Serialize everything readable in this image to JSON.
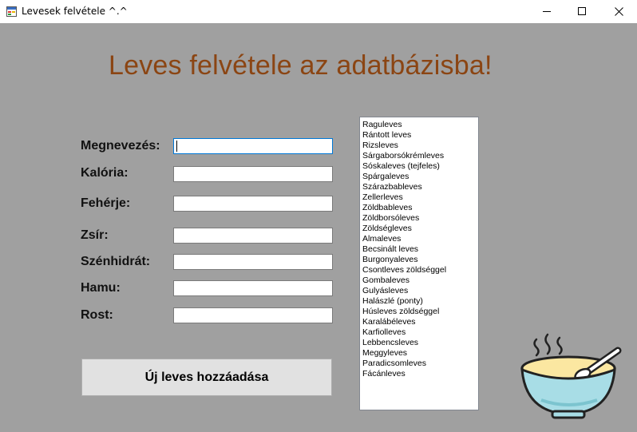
{
  "window": {
    "title": "Levesek felvétele ^.^",
    "icon": "app-form-icon"
  },
  "form": {
    "heading": "Leves felvétele az adatbázisba!",
    "heading_color": "#8b4513",
    "fields": [
      {
        "label": "Megnevezés:",
        "value": ""
      },
      {
        "label": "Kalória:",
        "value": ""
      },
      {
        "label": "Fehérje:",
        "value": ""
      },
      {
        "label": "Zsír:",
        "value": ""
      },
      {
        "label": "Szénhidrát:",
        "value": ""
      },
      {
        "label": "Hamu:",
        "value": ""
      },
      {
        "label": "Rost:",
        "value": ""
      }
    ],
    "add_button_label": "Új leves hozzáadása"
  },
  "soup_list": {
    "items": [
      "Raguleves",
      "Rántott leves",
      "Rizsleves",
      "Sárgaborsókrémleves",
      "Sóskaleves (tejfeles)",
      "Spárgaleves",
      "Szárazbableves",
      "Zellerleves",
      "Zöldbableves",
      "Zöldborsóleves",
      "Zöldségleves",
      "Almaleves",
      "Becsinált leves",
      "Burgonyaleves",
      "Csontleves zöldséggel",
      "Gombaleves",
      "Gulyásleves",
      "Halászlé (ponty)",
      "Húsleves zöldséggel",
      "Karalábéleves",
      "Karfiolleves",
      "Lebbencsleves",
      "Meggyleves",
      "Paradicsomleves",
      "Fácánleves"
    ]
  },
  "decor": {
    "image": "soup-bowl-icon"
  }
}
